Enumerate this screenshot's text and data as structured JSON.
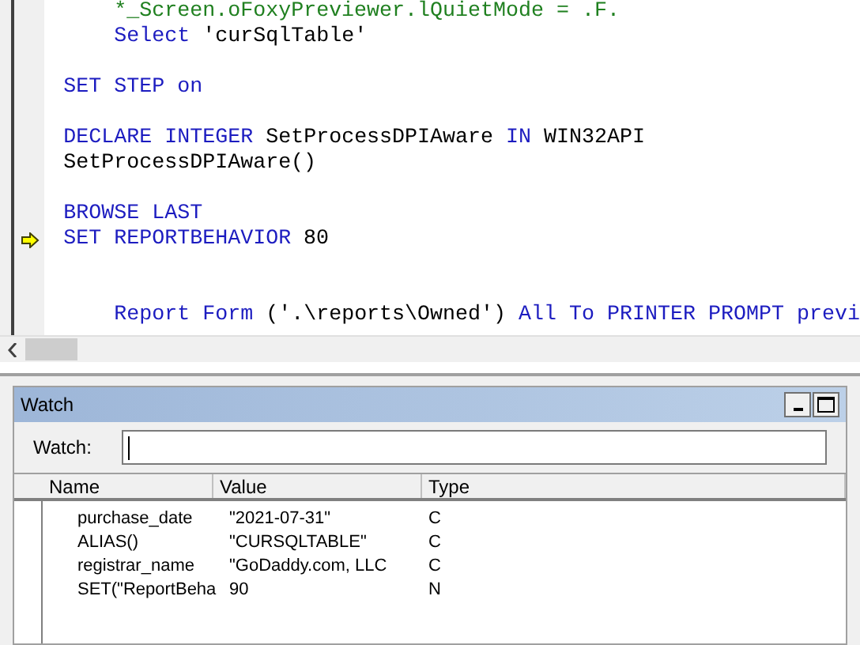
{
  "editor": {
    "lines": [
      {
        "kind": "code",
        "indent": true,
        "current": false,
        "tokens": [
          {
            "kind": "comment",
            "text": "*_Screen.oFoxyPreviewer.lQuietMode = .F."
          }
        ]
      },
      {
        "kind": "code",
        "indent": true,
        "current": false,
        "tokens": [
          {
            "kind": "keyword",
            "text": "Select"
          },
          {
            "kind": "plain",
            "text": " 'curSqlTable'"
          }
        ]
      },
      {
        "kind": "blank"
      },
      {
        "kind": "code",
        "indent": false,
        "current": false,
        "tokens": [
          {
            "kind": "keyword",
            "text": "SET STEP on"
          }
        ]
      },
      {
        "kind": "blank"
      },
      {
        "kind": "code",
        "indent": false,
        "current": false,
        "tokens": [
          {
            "kind": "keyword",
            "text": "DECLARE INTEGER"
          },
          {
            "kind": "plain",
            "text": " SetProcessDPIAware "
          },
          {
            "kind": "keyword",
            "text": "IN"
          },
          {
            "kind": "plain",
            "text": " WIN32API"
          }
        ]
      },
      {
        "kind": "code",
        "indent": false,
        "current": false,
        "tokens": [
          {
            "kind": "plain",
            "text": "SetProcessDPIAware()"
          }
        ]
      },
      {
        "kind": "blank"
      },
      {
        "kind": "code",
        "indent": false,
        "current": false,
        "tokens": [
          {
            "kind": "keyword",
            "text": "BROWSE LAST"
          }
        ]
      },
      {
        "kind": "code",
        "indent": false,
        "current": true,
        "tokens": [
          {
            "kind": "keyword",
            "text": "SET REPORTBEHAVIOR"
          },
          {
            "kind": "plain",
            "text": " 80"
          }
        ]
      },
      {
        "kind": "blank"
      },
      {
        "kind": "blank"
      },
      {
        "kind": "code",
        "indent": true,
        "current": false,
        "tokens": [
          {
            "kind": "keyword",
            "text": "Report Form"
          },
          {
            "kind": "plain",
            "text": " ('.\\reports\\Owned') "
          },
          {
            "kind": "keyword",
            "text": "All To PRINTER PROMPT previ"
          }
        ]
      }
    ]
  },
  "watch": {
    "title": "Watch",
    "field_label": "Watch:",
    "columns": [
      "Name",
      "Value",
      "Type"
    ],
    "rows": [
      {
        "name": "purchase_date",
        "value": "\"2021-07-31\"",
        "type": "C"
      },
      {
        "name": "ALIAS()",
        "value": "\"CURSQLTABLE\"",
        "type": "C"
      },
      {
        "name": "registrar_name",
        "value": "\"GoDaddy.com, LLC",
        "type": "C"
      },
      {
        "name": "SET(\"ReportBeha",
        "value": "90",
        "type": "N"
      }
    ]
  }
}
